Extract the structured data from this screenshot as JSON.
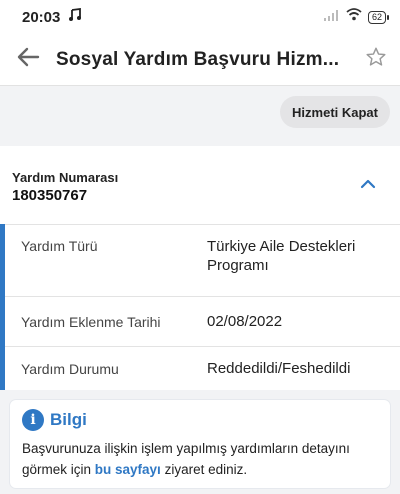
{
  "status_bar": {
    "time": "20:03",
    "battery": "62",
    "icons": [
      "music-note-icon",
      "signal-icon",
      "wifi-icon",
      "battery-icon"
    ]
  },
  "header": {
    "title": "Sosyal Yardım Başvuru Hizm...",
    "back_icon": "arrow-left-icon",
    "favorite_icon": "star-outline-icon"
  },
  "close_service_label": "Hizmeti Kapat",
  "card": {
    "label": "Yardım Numarası",
    "number": "180350767",
    "chevron_icon": "chevron-up-icon",
    "rows": [
      {
        "key": "Yardım Türü",
        "value": "Türkiye Aile Destekleri Programı"
      },
      {
        "key": "Yardım Eklenme Tarihi",
        "value": "02/08/2022"
      },
      {
        "key": "Yardım Durumu",
        "value": "Reddedildi/Feshedildi"
      }
    ]
  },
  "info": {
    "icon": "info-icon",
    "title": "Bilgi",
    "text_before": "Başvurunuza ilişkin işlem yapılmış yardımların detayını görmek için ",
    "link": "bu sayfayı",
    "text_after": " ziyaret ediniz."
  },
  "colors": {
    "accent": "#2f78c4",
    "background": "#f2f3f5",
    "surface": "#ffffff"
  }
}
